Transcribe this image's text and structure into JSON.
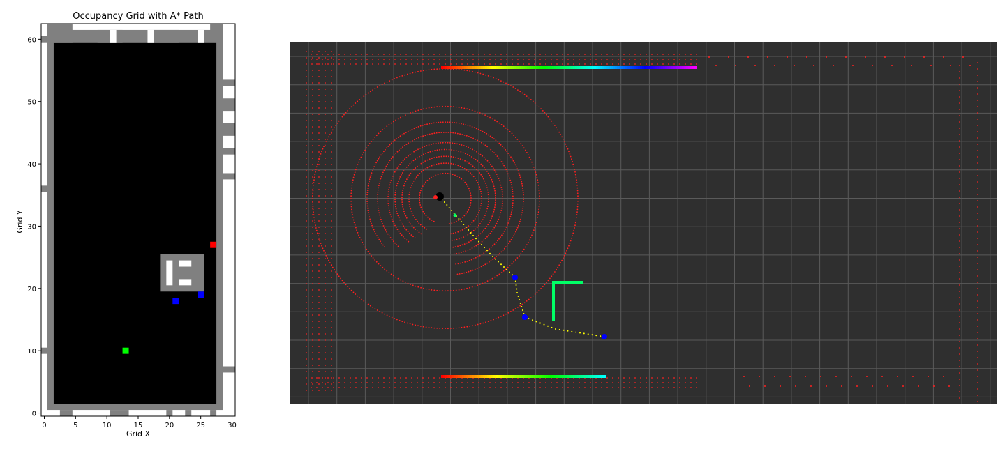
{
  "chart_data": [
    {
      "type": "heatmap",
      "title": "Occupancy Grid with A* Path",
      "xlabel": "Grid X",
      "ylabel": "Grid Y",
      "xlim": [
        -0.5,
        30.5
      ],
      "ylim": [
        -0.5,
        62.5
      ],
      "xticks": [
        0,
        5,
        10,
        15,
        20,
        25,
        30
      ],
      "yticks": [
        0,
        10,
        20,
        30,
        40,
        50,
        60
      ],
      "grid": false,
      "colors": {
        "free": "#000000",
        "wall": "#808080",
        "unknown": "#ffffff",
        "start": "#00ff00",
        "goal": "#ff0000",
        "waypoint": "#0000ff"
      },
      "markers": [
        {
          "name": "start",
          "x": 13,
          "y": 10,
          "color": "#00ff00"
        },
        {
          "name": "goal",
          "x": 27,
          "y": 27,
          "color": "#ff0000"
        },
        {
          "name": "waypoint",
          "x": 21,
          "y": 18,
          "color": "#0000ff"
        },
        {
          "name": "waypoint",
          "x": 25,
          "y": 19,
          "color": "#0000ff"
        }
      ],
      "obstacle_block": {
        "x_range": [
          19,
          25
        ],
        "y_range": [
          20,
          25
        ],
        "color": "#808080"
      }
    },
    {
      "type": "scatter",
      "title": "",
      "background": "#2f2f2f",
      "grid": true,
      "series_colors": {
        "points": "#ff2020",
        "path": "#ffff00",
        "waypoints": "#0000ff",
        "robot": "#000000",
        "obstacle": "#00ff66"
      }
    }
  ]
}
